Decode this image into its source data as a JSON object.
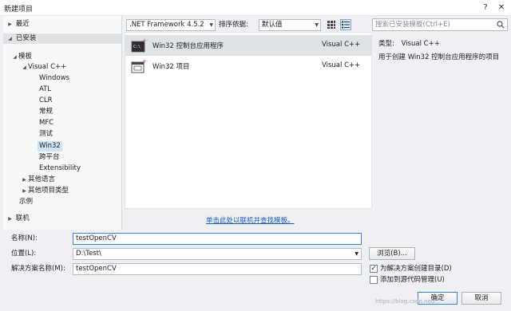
{
  "window": {
    "title": "新建项目",
    "help_label": "?",
    "close_label": "✕"
  },
  "tree": {
    "recent": "最近",
    "installed": "已安装",
    "templates": "模板",
    "visual_cpp": "Visual C++",
    "windows": "Windows",
    "atl": "ATL",
    "clr": "CLR",
    "general": "常规",
    "mfc": "MFC",
    "test": "测试",
    "win32": "Win32",
    "cross_platform": "跨平台",
    "extensibility": "Extensibility",
    "other_languages": "其他语言",
    "other_project_types": "其他项目类型",
    "samples": "示例",
    "online": "联机"
  },
  "toolbar": {
    "framework": ".NET Framework 4.5.2",
    "sort_label": "排序依据:",
    "sort_value": "默认值"
  },
  "templates": [
    {
      "name": "Win32 控制台应用程序",
      "language": "Visual C++"
    },
    {
      "name": "Win32 项目",
      "language": "Visual C++"
    }
  ],
  "online_link": "单击此处以联机并查找模板。",
  "search": {
    "placeholder": "搜索已安装模板(Ctrl+E)"
  },
  "details": {
    "type_label": "类型:",
    "type_value": "Visual C++",
    "description": "用于创建 Win32 控制台应用程序的项目"
  },
  "form": {
    "name_label": "名称(N):",
    "name_value": "testOpenCV",
    "location_label": "位置(L):",
    "location_value": "D:\\Test\\",
    "solution_label": "解决方案名称(M):",
    "solution_value": "testOpenCV",
    "browse_label": "浏览(B)...",
    "create_dir_label": "为解决方案创建目录(D)",
    "create_dir_checked": true,
    "source_control_label": "添加到源代码管理(U)",
    "source_control_checked": false,
    "ok_label": "确定",
    "cancel_label": "取消"
  },
  "watermark": "https://blog.csdn.net/..."
}
